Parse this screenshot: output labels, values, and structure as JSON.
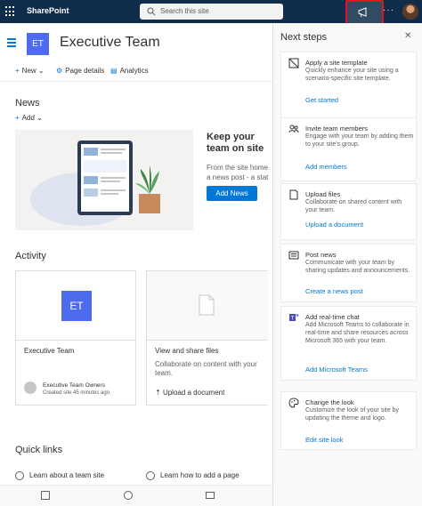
{
  "suite": {
    "brand": "SharePoint",
    "search_placeholder": "Search this site",
    "more": "···"
  },
  "site": {
    "logo": "ET",
    "title": "Executive Team"
  },
  "command_bar": {
    "new": "New",
    "page_details": "Page details",
    "analytics": "Analytics"
  },
  "news": {
    "heading": "News",
    "add": "Add",
    "keep_title": "Keep your team on site",
    "desc_line1": "From the site home",
    "desc_line2": "a news post - a stat",
    "add_news": "Add News"
  },
  "activity": {
    "heading": "Activity",
    "card1": {
      "logo": "ET",
      "title": "Executive Team",
      "owner": "Executive Team Owners",
      "created": "Created site 45 minutes ago"
    },
    "card2": {
      "title": "View and share files",
      "desc": "Collaborate on content with your team.",
      "upload": "Upload a document"
    }
  },
  "quick_links": {
    "heading": "Quick links",
    "items": [
      "Learn about a team site",
      "Learn how to add a page"
    ]
  },
  "panel": {
    "title": "Next steps",
    "steps": [
      {
        "icon": "template-icon",
        "title": "Apply a site template",
        "desc": "Quickly enhance your site using a scenario-specific site template.",
        "link": "Get started"
      },
      {
        "icon": "people-icon",
        "title": "Invite team members",
        "desc": "Engage with your team by adding them to your site's group.",
        "link": "Add members"
      },
      {
        "icon": "document-icon",
        "title": "Upload files",
        "desc": "Collaborate on shared content with your team.",
        "link": "Upload a document"
      },
      {
        "icon": "news-icon",
        "title": "Post news",
        "desc": "Communicate with your team by sharing updates and announcements.",
        "link": "Create a news post"
      },
      {
        "icon": "teams-icon",
        "title": "Add real-time chat",
        "desc": "Add Microsoft Teams to collaborate in real-time and share resources across Microsoft 365 with your team.",
        "link": "Add Microsoft Teams"
      },
      {
        "icon": "palette-icon",
        "title": "Change the look",
        "desc": "Customize the look of your site by updating the theme and logo.",
        "link": "Edit site look"
      }
    ]
  },
  "colors": {
    "suitebar": "#0f2c4a",
    "accent": "#0078d4",
    "site_logo": "#4f6bed",
    "highlight": "#e81123"
  }
}
